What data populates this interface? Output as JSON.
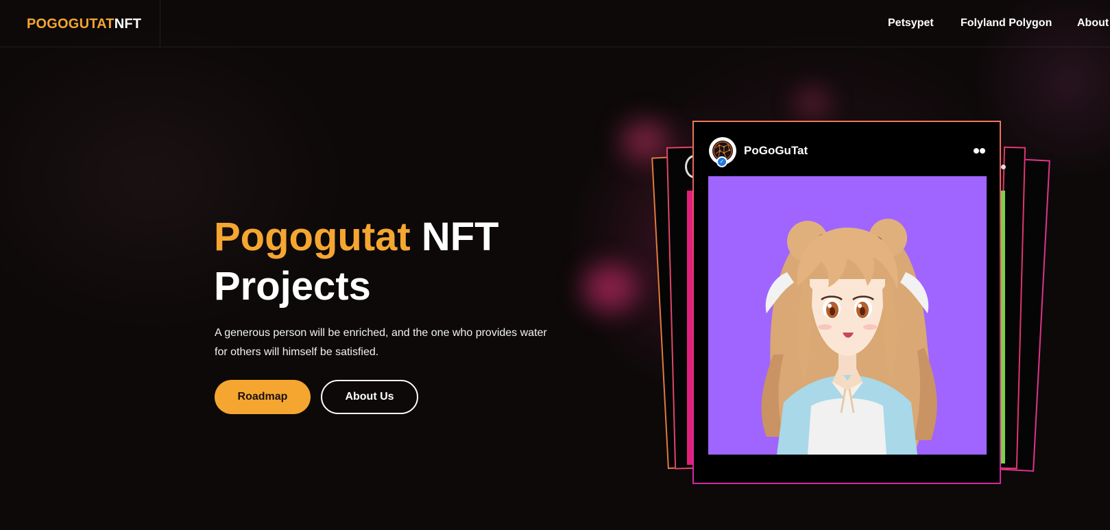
{
  "brand": {
    "logo_part1": "POGOGUTAT",
    "logo_part2": "NFT"
  },
  "nav": {
    "items": [
      {
        "label": "Petsypet"
      },
      {
        "label": "Folyland Polygon"
      },
      {
        "label": "About"
      }
    ]
  },
  "hero": {
    "title_accent": "Pogogutat",
    "title_rest": " NFT Projects",
    "description": "A generous person will be enriched, and the one who provides water for others will himself be satisfied.",
    "primary_button": "Roadmap",
    "secondary_button": "About Us"
  },
  "card": {
    "name": "PoGoGuTat",
    "verified_icon": "check-icon",
    "image_bg": "#a065ff"
  },
  "colors": {
    "accent": "#f5a631",
    "background": "#0d0909",
    "card_border": "#e6386e"
  }
}
